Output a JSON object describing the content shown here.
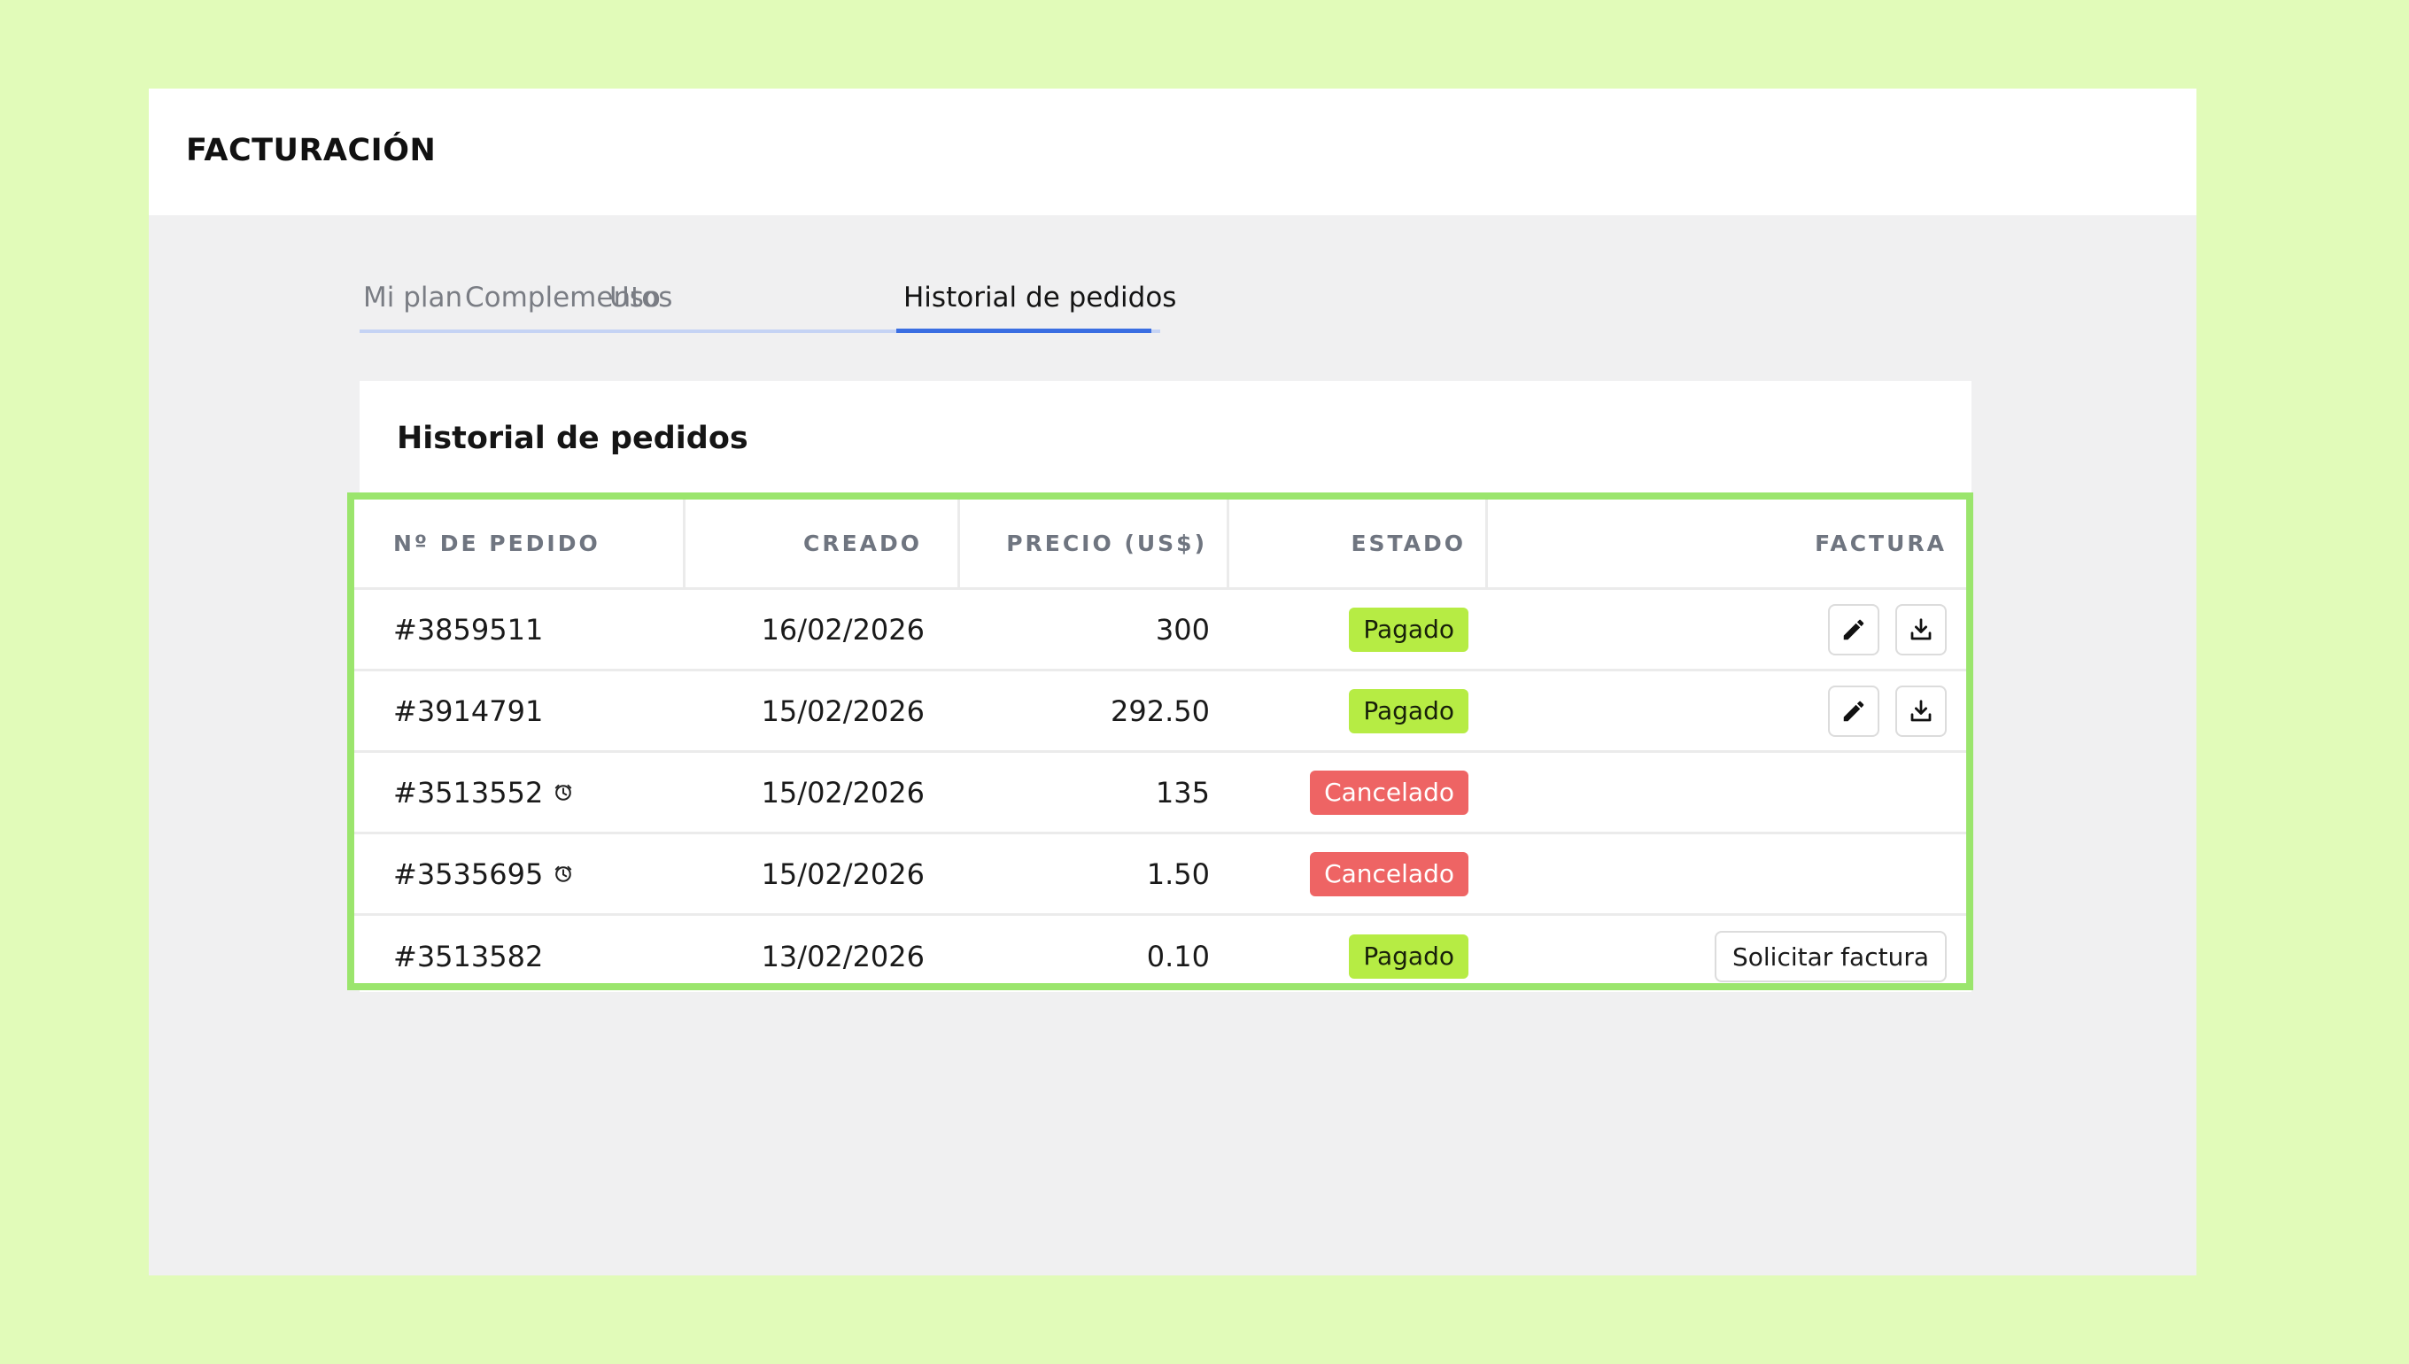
{
  "app": {
    "title": "FACTURACIÓN"
  },
  "tabs": [
    {
      "label": "Mi plan",
      "active": false
    },
    {
      "label": "Complementos",
      "active": false
    },
    {
      "label": "Uso",
      "active": false
    },
    {
      "label": "Historial de pedidos",
      "active": true
    }
  ],
  "card": {
    "title": "Historial de pedidos"
  },
  "table": {
    "columns": [
      "Nº DE PEDIDO",
      "CREADO",
      "PRECIO (US$)",
      "ESTADO",
      "FACTURA"
    ],
    "rows": [
      {
        "order": "#3859511",
        "created": "16/02/2026",
        "price": "300",
        "status": "Pagado",
        "pending_icon": false
      },
      {
        "order": "#3914791",
        "created": "15/02/2026",
        "price": "292.50",
        "status": "Pagado",
        "pending_icon": false
      },
      {
        "order": "#3513552",
        "created": "15/02/2026",
        "price": "135",
        "status": "Cancelado",
        "pending_icon": true
      },
      {
        "order": "#3535695",
        "created": "15/02/2026",
        "price": "1.50",
        "status": "Cancelado",
        "pending_icon": true
      },
      {
        "order": "#3513582",
        "created": "13/02/2026",
        "price": "0.10",
        "status": "Pagado",
        "pending_icon": false
      }
    ],
    "request_invoice_label": "Solicitar factura"
  },
  "colors": {
    "background": "#e1fbb9",
    "highlight_border": "#9be56d",
    "tab_active": "#3a6ee2",
    "badge_paid": "#b6ec44",
    "badge_cancel": "#ee6464"
  },
  "icons": [
    "clock-icon",
    "edit-pencil-icon",
    "download-icon"
  ]
}
